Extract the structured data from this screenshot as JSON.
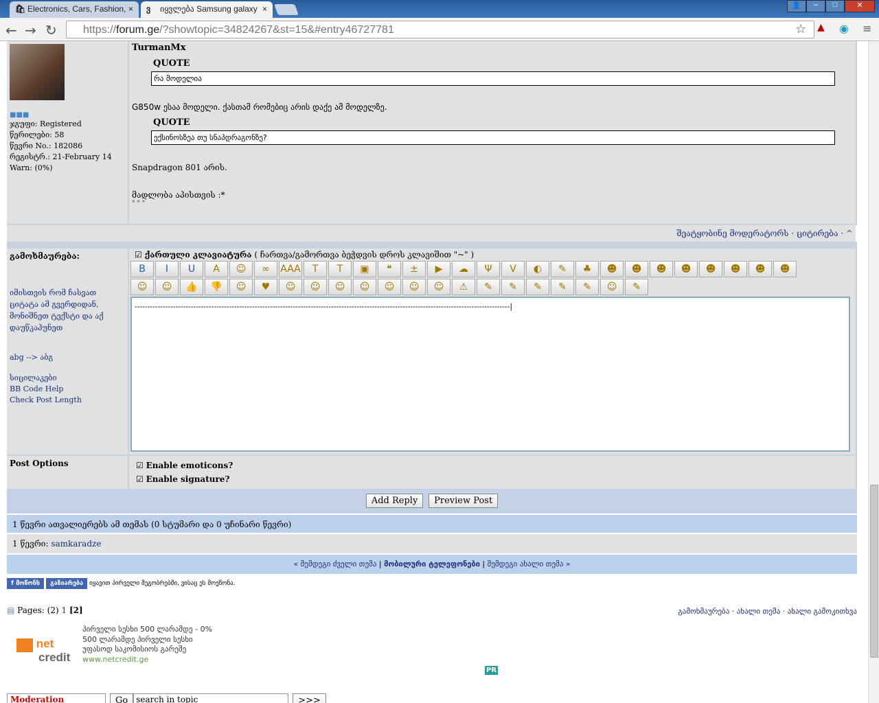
{
  "browser": {
    "tabs": [
      {
        "label": "Electronics, Cars, Fashion,",
        "icon": "shopping-bag-icon"
      },
      {
        "label": "იყვლება Samsung galaxy",
        "icon": "forum-logo-icon"
      }
    ],
    "url_prefix": "https://",
    "url_domain": "forum.ge",
    "url_path": "/?showtopic=34824267&st=15&#entry46727781"
  },
  "post": {
    "author": "TurmanMx",
    "group": "ჯგუფი: Registered",
    "posts": "წერილები: 58",
    "member_no": "წევრი No.: 182086",
    "registered": "რეგისტრ.: 21-February 14",
    "warn": "Warn: (0%)",
    "quote_label": "QUOTE",
    "quote1": "რა მოდელია",
    "text1": "G850w ესაა მოდელი. ქასთამ რომებიც არის დაქე ამ მოდელზე.",
    "quote2": "ექსინოსზეა თუ სნაპდრაგონზე?",
    "text2": "Snapdragon 801 არის.",
    "text3": "მადლობა აპისთვის :*",
    "sig": "* * *",
    "actions": "შეატყობინე მოდერატორს  · ციტირება · ^"
  },
  "reply": {
    "label": "გამოხმაურება:",
    "hint": "იმისთვის რომ ჩასვათ ციტატა ამ გვერდიდან, მონიშნეთ ტექსტი და აქ დაუწკაპუნეთ",
    "abg": "abg --> აბგ",
    "smilies": "სიცილაკები",
    "bbcode": "BB Code Help",
    "check": "Check Post Length",
    "keyboard_label": "ქართული კლავიატურა",
    "keyboard_hint": "( ჩართვა/გამორთვა ბეჭდვის დროს კლავიშით \"~\" )",
    "editor_value": "---------------------------------------------------------------------------------------------------------------------------------------------------|",
    "toolbar_row1": [
      "B",
      "I",
      "U",
      "A",
      "☺",
      "∞",
      "AAA",
      "T",
      "T",
      "▣",
      "❝",
      "±",
      "▶",
      "☁",
      "Ψ",
      "V",
      "◐",
      "✎",
      "♣",
      "☻",
      "☻",
      "☻",
      "☻",
      "☻",
      "☻",
      "☻",
      "☻"
    ],
    "toolbar_row2": [
      "☺",
      "☺",
      "👍",
      "👎",
      "☺",
      "♥",
      "☺",
      "☺",
      "☺",
      "☺",
      "☺",
      "☺",
      "☺",
      "⚠",
      "✎",
      "✎",
      "✎",
      "✎",
      "✎",
      "☺",
      "✎"
    ]
  },
  "options": {
    "label": "Post Options",
    "emoticons": "Enable emoticons?",
    "signature": "Enable signature?",
    "add_reply": "Add Reply",
    "preview": "Preview Post"
  },
  "viewers": {
    "count": "1 წევრი ათვალიერებს ამ თემას (0 სტუმარი და 0 უჩინარი წევრი)",
    "members": "1 წევრი: ",
    "member_name": "samkaradze"
  },
  "topicnav": {
    "prev": "« შემდეგი ძველი თემა",
    "forum": "მობილური ტელეფონები",
    "next": "შემდეგი ახალი თემა »"
  },
  "facebook": {
    "like": "მოწონს",
    "share": "გაზიარება",
    "text": "იყავით პირველი მეგობრებში, ვისაც ეს მოეწონა."
  },
  "pages": {
    "label": "Pages: (2)",
    "p1": "1",
    "current": "[2]"
  },
  "bottom_links": "გამოხმაურება · ახალი თემა · ახალი გამოკითხვა",
  "ad": {
    "logo": "net credit",
    "l1": "პირველი სესხი 500 ლარამდე - 0%",
    "l2": "500 ლარამდე პირველი სესხი",
    "l3": "უფასოდ საკომისიოს გარეშე",
    "url": "www.netcredit.ge"
  },
  "pr": "PR",
  "footer": {
    "mod": "Moderation Options",
    "go": "Go",
    "search_placeholder": "search in topic",
    "next": ">>>"
  }
}
